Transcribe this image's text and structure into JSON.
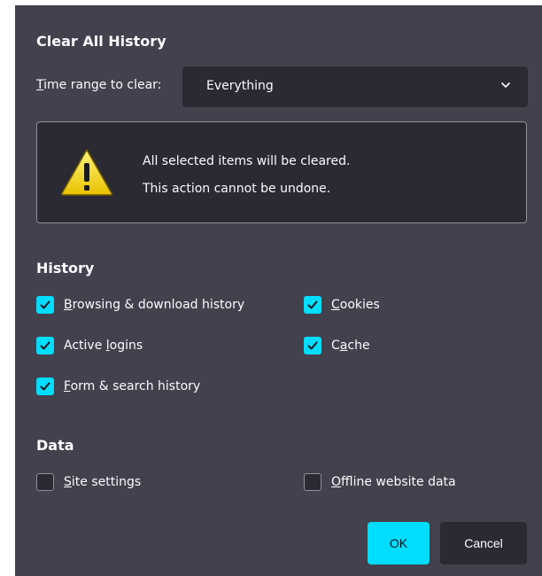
{
  "dialog": {
    "title": "Clear All History",
    "time_range": {
      "label_access": "T",
      "label_rest": "ime range to clear:",
      "selected": "Everything"
    },
    "warning": {
      "line1": "All selected items will be cleared.",
      "line2": "This action cannot be undone."
    },
    "history": {
      "title": "History",
      "items": [
        {
          "pre": "",
          "key": "B",
          "post": "rowsing & download history",
          "checked": true
        },
        {
          "pre": "",
          "key": "C",
          "post": "ookies",
          "checked": true
        },
        {
          "pre": "Active ",
          "key": "l",
          "post": "ogins",
          "checked": true
        },
        {
          "pre": "C",
          "key": "a",
          "post": "che",
          "checked": true
        },
        {
          "pre": "",
          "key": "F",
          "post": "orm & search history",
          "checked": true
        }
      ]
    },
    "data": {
      "title": "Data",
      "items": [
        {
          "pre": "",
          "key": "S",
          "post": "ite settings",
          "checked": false
        },
        {
          "pre": "",
          "key": "O",
          "post": "ffline website data",
          "checked": false
        }
      ]
    },
    "buttons": {
      "ok": "OK",
      "cancel": "Cancel"
    },
    "colors": {
      "dialog_bg": "#42414d",
      "field_bg": "#2b2a33",
      "accent": "#00ddff",
      "text": "#fbfbfe"
    }
  }
}
